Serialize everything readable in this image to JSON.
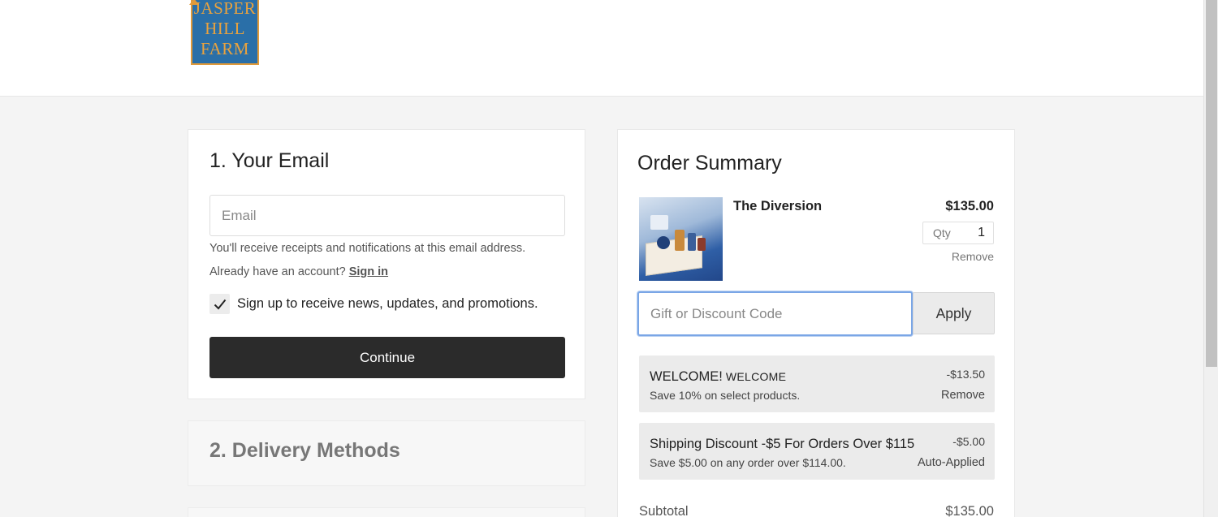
{
  "header": {
    "logo": {
      "line1": "JASPER",
      "line2": "HILL",
      "line3": "FARM"
    }
  },
  "email_step": {
    "title": "1.  Your Email",
    "email_placeholder": "Email",
    "email_value": "",
    "receipts_note": "You'll receive receipts and notifications at this email address.",
    "account_prompt": "Already have an account?",
    "signin_label": "Sign in",
    "newsletter_label": "Sign up to receive news, updates, and promotions.",
    "newsletter_checked": true,
    "continue_label": "Continue"
  },
  "delivery_step": {
    "title": "2.  Delivery Methods"
  },
  "order_summary": {
    "title": "Order Summary",
    "items": [
      {
        "name": "The Diversion",
        "price": "$135.00",
        "qty_label": "Qty",
        "qty": "1",
        "remove_label": "Remove"
      }
    ],
    "discount_code": {
      "placeholder": "Gift or Discount Code",
      "value": "",
      "apply_label": "Apply"
    },
    "discounts": [
      {
        "title": "WELCOME!",
        "code": "WELCOME",
        "description": "Save 10% on select products.",
        "amount": "-$13.50",
        "action": "Remove"
      },
      {
        "title": "Shipping Discount -$5 For Orders Over $115",
        "code": "",
        "description": "Save $5.00 on any order over $114.00.",
        "amount": "-$5.00",
        "action": "Auto-Applied"
      }
    ],
    "subtotal_label": "Subtotal",
    "subtotal_value": "$135.00"
  },
  "colors": {
    "brand_blue": "#2a6fa8",
    "brand_orange": "#e09a3a",
    "button_dark": "#2b2b2b",
    "focus_blue": "#7aa6e6"
  },
  "icons": {
    "checkbox": "checkmark-icon"
  }
}
